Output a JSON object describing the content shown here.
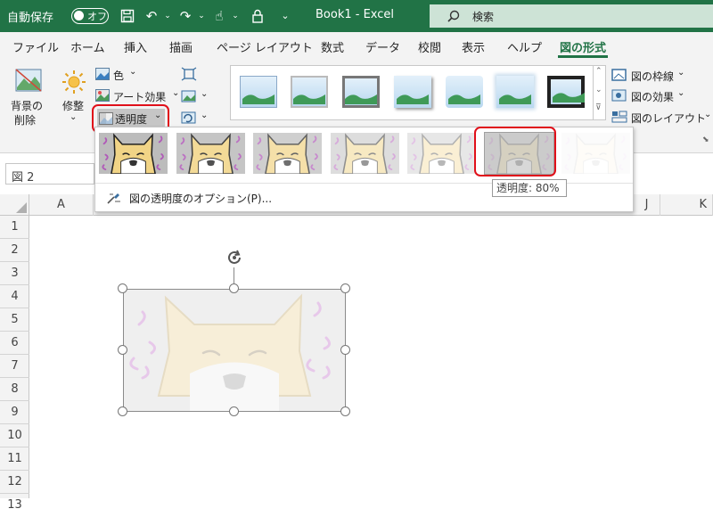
{
  "titlebar": {
    "autosave_label": "自動保存",
    "autosave_state": "オフ",
    "doc_title": "Book1 - Excel",
    "search_placeholder": "検索"
  },
  "tabs": [
    {
      "label": "ファイル"
    },
    {
      "label": "ホーム"
    },
    {
      "label": "挿入"
    },
    {
      "label": "描画"
    },
    {
      "label": "ページ レイアウト"
    },
    {
      "label": "数式"
    },
    {
      "label": "データ"
    },
    {
      "label": "校閲"
    },
    {
      "label": "表示"
    },
    {
      "label": "ヘルプ"
    },
    {
      "label": "図の形式",
      "active": true
    }
  ],
  "ribbon": {
    "remove_bg_line1": "背景の",
    "remove_bg_line2": "削除",
    "corrections": "修整",
    "color": "色",
    "artistic": "アート効果",
    "transparency": "透明度",
    "border": "図の枠線",
    "effects": "図の効果",
    "layout": "図のレイアウト"
  },
  "namebox": "図 2",
  "dropdown": {
    "levels": [
      0,
      15,
      30,
      50,
      65,
      80,
      95
    ],
    "selected_level": 80,
    "options_label": "図の透明度のオプション(P)...",
    "tooltip": "透明度: 80%"
  },
  "columns": [
    "A",
    "J",
    "K"
  ],
  "rows": [
    "1",
    "2",
    "3",
    "4",
    "5",
    "6",
    "7",
    "8",
    "9",
    "10",
    "11",
    "12",
    "13"
  ],
  "colors": {
    "excel_green": "#217346",
    "highlight_red": "#e0101a"
  }
}
